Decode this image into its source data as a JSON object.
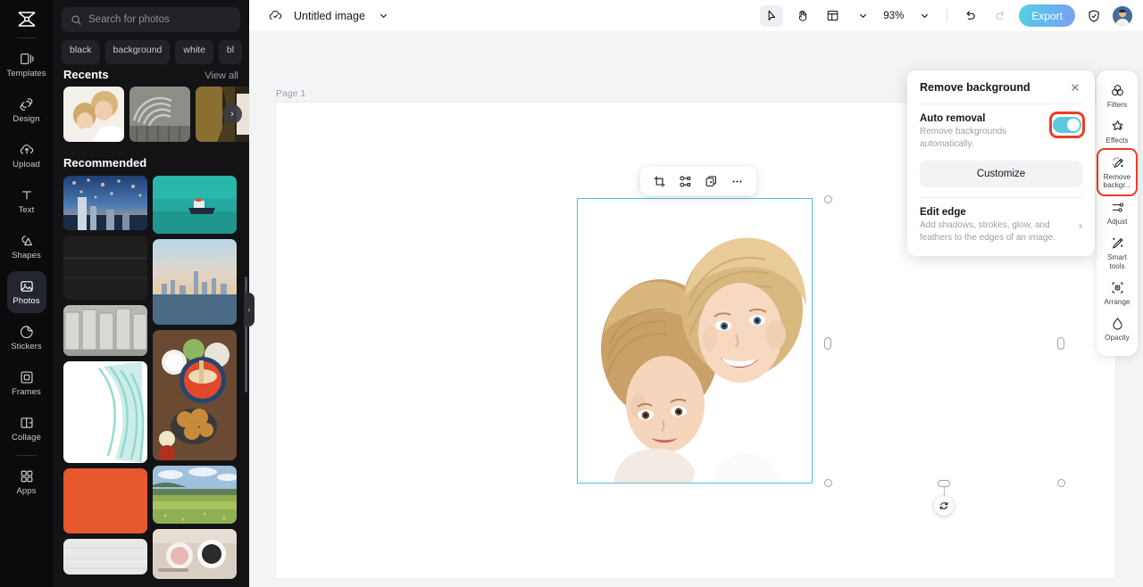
{
  "app": {
    "logo_name": "capcut-logo"
  },
  "left_rail": {
    "items": [
      {
        "label": "Templates",
        "icon": "templates-icon",
        "active": false
      },
      {
        "label": "Design",
        "icon": "design-icon",
        "active": false
      },
      {
        "label": "Upload",
        "icon": "upload-icon",
        "active": false
      },
      {
        "label": "Text",
        "icon": "text-icon",
        "active": false
      },
      {
        "label": "Shapes",
        "icon": "shapes-icon",
        "active": false
      },
      {
        "label": "Photos",
        "icon": "photos-icon",
        "active": true
      },
      {
        "label": "Stickers",
        "icon": "stickers-icon",
        "active": false
      },
      {
        "label": "Frames",
        "icon": "frames-icon",
        "active": false
      },
      {
        "label": "Collage",
        "icon": "collage-icon",
        "active": false
      },
      {
        "label": "Apps",
        "icon": "apps-icon",
        "active": false
      }
    ]
  },
  "panel": {
    "search": {
      "placeholder": "Search for photos",
      "value": "",
      "icon": "search-icon"
    },
    "tags": [
      "black",
      "background",
      "white",
      "bl"
    ],
    "recents": {
      "title": "Recents",
      "view_all": "View all",
      "next_icon": "chevron-right-icon"
    },
    "recommended": {
      "title": "Recommended"
    },
    "collapse_icon": "chevron-left-icon"
  },
  "topbar": {
    "cloud_icon": "cloud-saved-icon",
    "doc_title": "Untitled image",
    "title_chevron": "chevron-down-icon",
    "select_tool_icon": "cursor-select-icon",
    "hand_tool_icon": "hand-pan-icon",
    "layout_icon": "page-layout-icon",
    "layout_chevron": "chevron-down-icon",
    "zoom_level": "93%",
    "zoom_chevron": "chevron-down-icon",
    "undo_icon": "undo-icon",
    "redo_icon": "redo-icon",
    "export_label": "Export",
    "shield_icon": "shield-check-icon",
    "avatar": "user-avatar"
  },
  "canvas": {
    "page_label": "Page 1",
    "element_toolbar": {
      "crop_icon": "crop-icon",
      "cutout_icon": "cutout-icon",
      "duplicate_icon": "duplicate-icon",
      "more_icon": "more-horizontal-icon"
    },
    "selection": {
      "rotate_icon": "rotate-icon"
    }
  },
  "remove_background_panel": {
    "title": "Remove background",
    "close_icon": "close-icon",
    "auto_removal": {
      "title": "Auto removal",
      "description": "Remove backgrounds automatically.",
      "toggle_on": true,
      "toggle_color": "#5bc8dd",
      "highlight_color": "#ee3d23"
    },
    "customize_label": "Customize",
    "edit_edge": {
      "title": "Edit edge",
      "description": "Add shadows, strokes, glow, and feathers to the edges of an image.",
      "chevron_icon": "chevron-right-icon"
    }
  },
  "right_rail": {
    "items": [
      {
        "label": "Filters",
        "icon": "filters-icon",
        "highlighted": false
      },
      {
        "label": "Effects",
        "icon": "effects-icon",
        "highlighted": false
      },
      {
        "label": "Remove\nbackgr...",
        "icon": "remove-bg-icon",
        "highlighted": true
      },
      {
        "label": "Adjust",
        "icon": "adjust-icon",
        "highlighted": false
      },
      {
        "label": "Smart\ntools",
        "icon": "smart-tools-icon",
        "highlighted": false
      },
      {
        "label": "Arrange",
        "icon": "arrange-icon",
        "highlighted": false
      },
      {
        "label": "Opacity",
        "icon": "opacity-icon",
        "highlighted": false
      }
    ]
  }
}
